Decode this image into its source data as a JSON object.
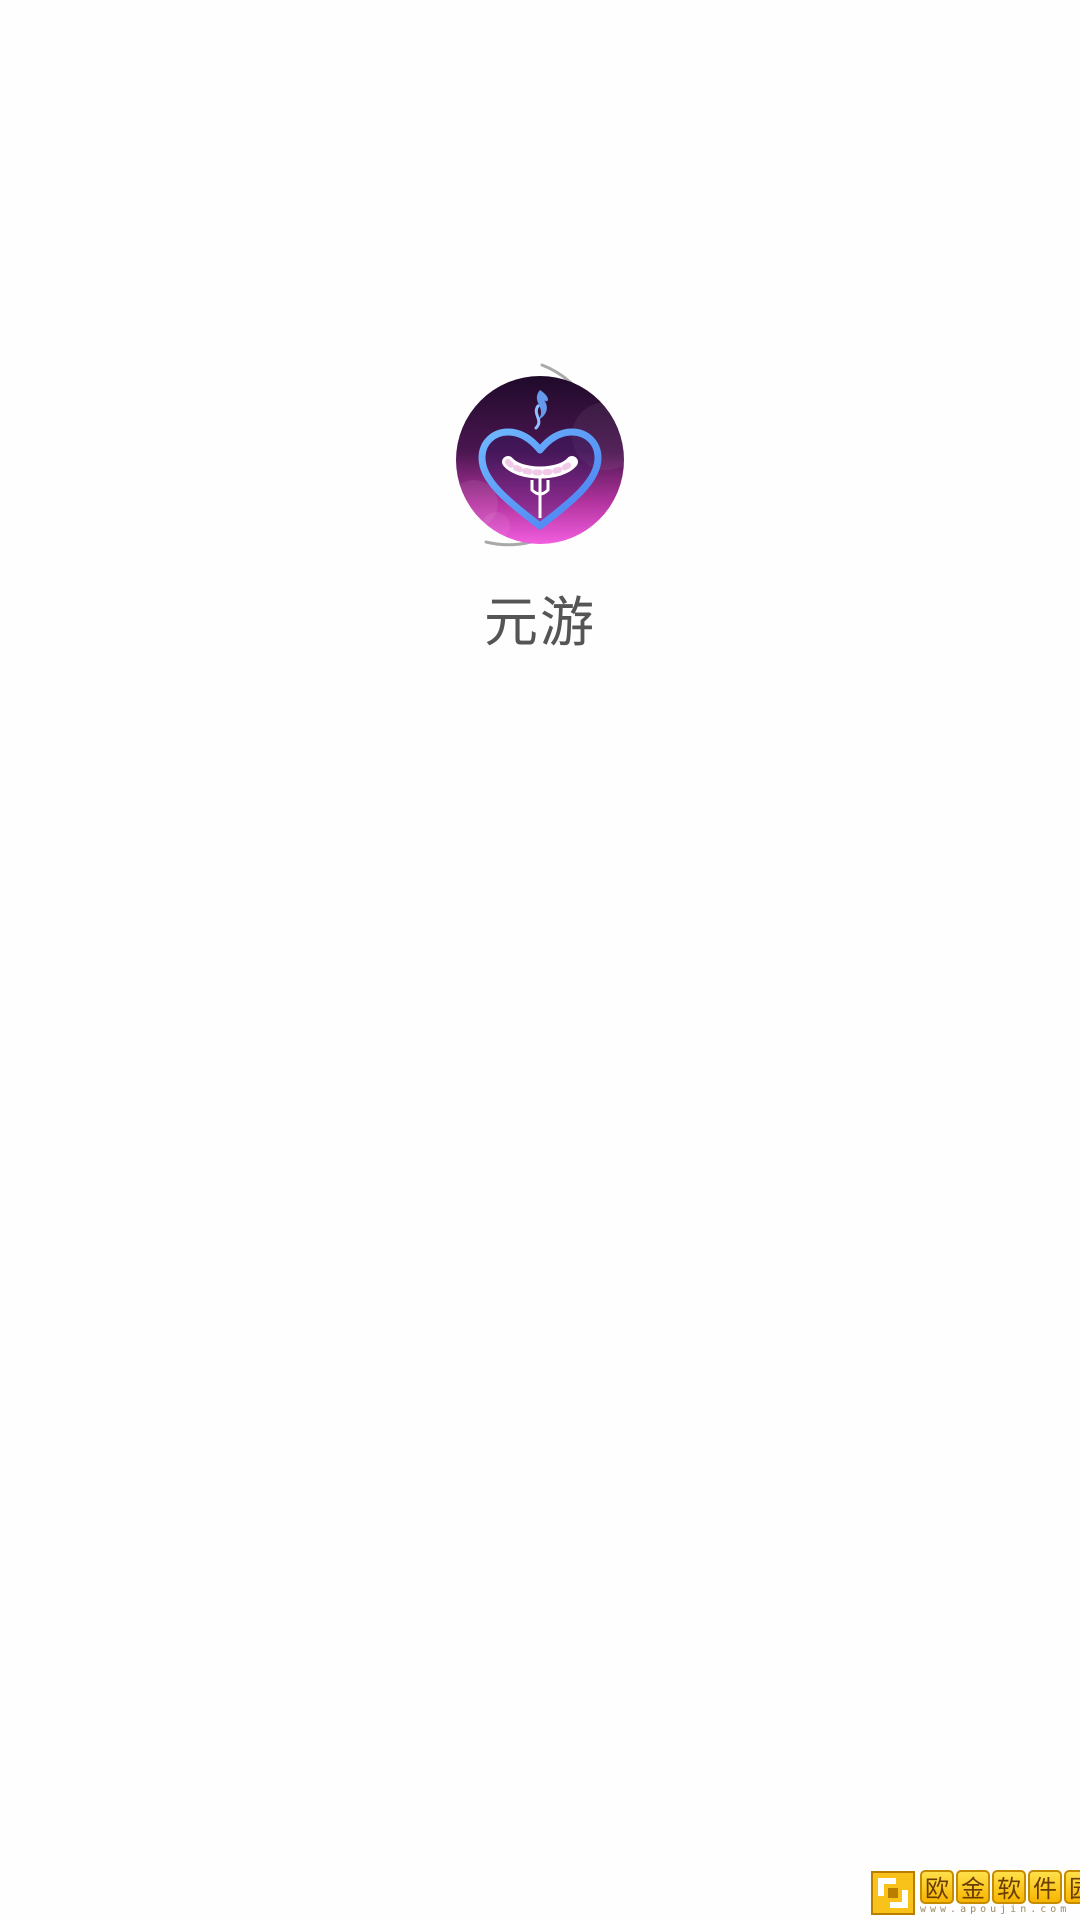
{
  "app": {
    "name": "元游",
    "load_progress": 0.5
  },
  "colors": {
    "background": "#fefefe",
    "ring": "#a9a9a9",
    "icon_top": "#2a0e36",
    "icon_bottom": "#e24fd5",
    "heart_stroke": "#4da3f5",
    "app_name_text": "#555555"
  },
  "icons": {
    "app_icon": "heart-sausage-icon"
  },
  "watermark": {
    "chars": [
      "欧",
      "金",
      "软",
      "件",
      "园"
    ],
    "url": "www.apoujin.com"
  }
}
